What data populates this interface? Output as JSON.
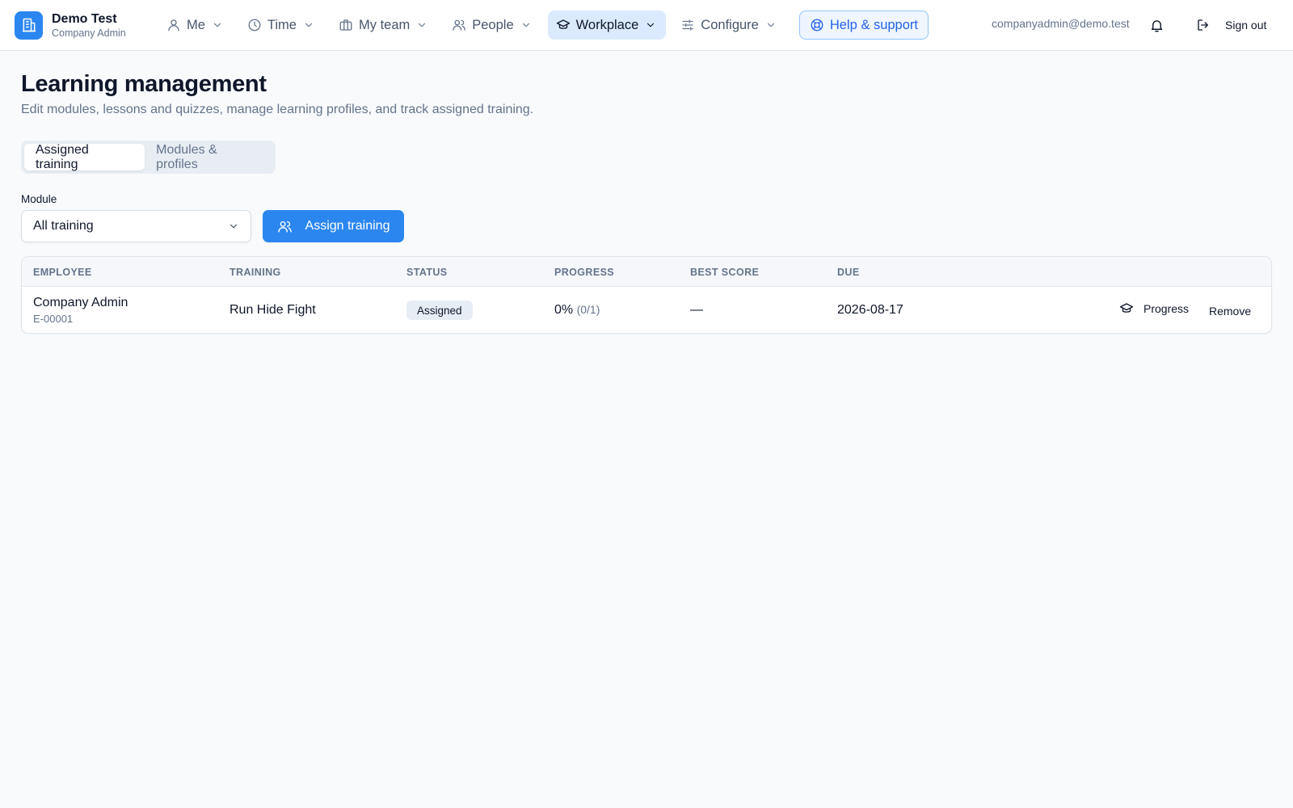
{
  "brand": {
    "name": "Demo Test",
    "role": "Company Admin",
    "logo_icon": "building-icon",
    "accent": "#2b86f0"
  },
  "nav": [
    {
      "label": "Me",
      "icon": "user-icon",
      "active": false
    },
    {
      "label": "Time",
      "icon": "clock-icon",
      "active": false
    },
    {
      "label": "My team",
      "icon": "briefcase-icon",
      "active": false
    },
    {
      "label": "People",
      "icon": "users-icon",
      "active": false
    },
    {
      "label": "Workplace",
      "icon": "graduation-cap-icon",
      "active": true
    },
    {
      "label": "Configure",
      "icon": "sliders-icon",
      "active": false
    }
  ],
  "help": {
    "label": "Help & support",
    "icon": "lifebuoy-icon"
  },
  "user": {
    "email": "companyadmin@demo.test",
    "signout_label": "Sign out"
  },
  "page": {
    "title": "Learning management",
    "subtitle": "Edit modules, lessons and quizzes, manage learning profiles, and track assigned training."
  },
  "tabs": [
    {
      "label": "Assigned training",
      "active": true
    },
    {
      "label": "Modules & profiles",
      "active": false
    }
  ],
  "filter": {
    "module_label": "Module",
    "module_value": "All training",
    "assign_label": "Assign training"
  },
  "table": {
    "columns": [
      "Employee",
      "Training",
      "Status",
      "Progress",
      "Best score",
      "Due"
    ],
    "rows": [
      {
        "employee_name": "Company Admin",
        "employee_id": "E-00001",
        "training": "Run Hide Fight",
        "status": "Assigned",
        "progress_pct": "0%",
        "progress_count": "(0/1)",
        "best_score": "—",
        "due": "2026-08-17",
        "action_progress": "Progress",
        "action_remove": "Remove"
      }
    ]
  }
}
